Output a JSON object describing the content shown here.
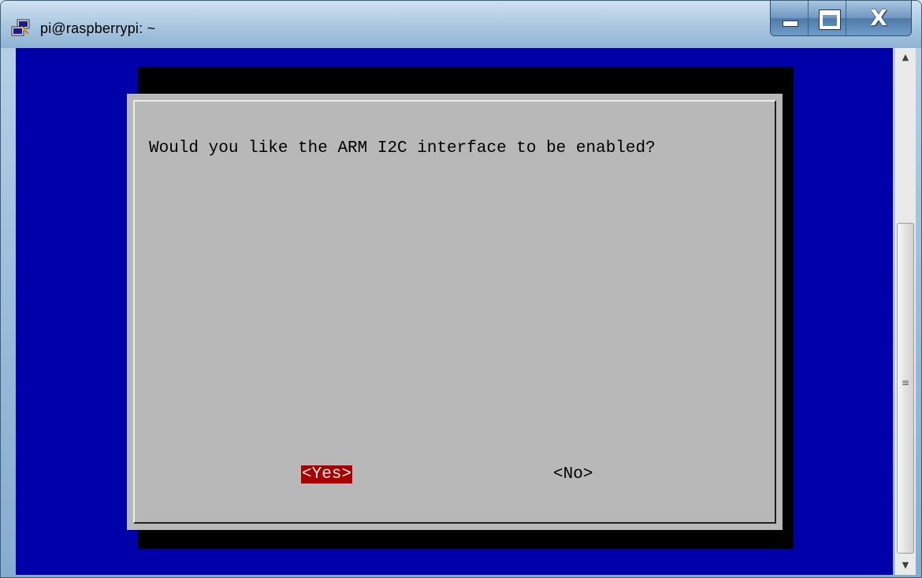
{
  "window": {
    "title": "pi@raspberrypi: ~"
  },
  "icons": {
    "app": "putty-icon",
    "minimize": "minimize-icon",
    "maximize": "maximize-icon",
    "close": "close-icon",
    "scroll_up": "scroll-up-arrow-icon",
    "scroll_down": "scroll-down-arrow-icon"
  },
  "dialog": {
    "question": "Would you like the ARM I2C interface to be enabled?",
    "yes_label": "<Yes>",
    "no_label": "<No>",
    "selected": "yes"
  },
  "colors": {
    "terminal_background": "#0000aa",
    "dialog_background": "#b8b8b8",
    "selected_button": "#aa0000"
  },
  "glyphs": {
    "close": "X",
    "scroll_up": "▲",
    "scroll_down": "▼",
    "grip": "≡"
  }
}
